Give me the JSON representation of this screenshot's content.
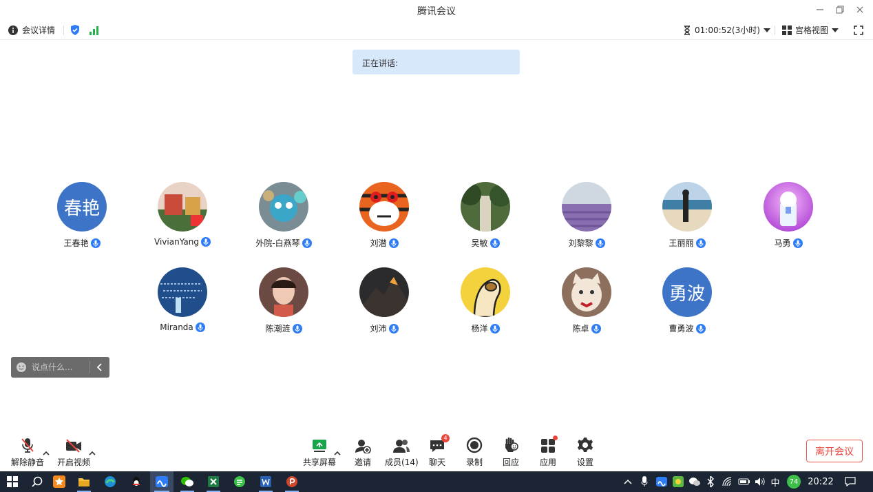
{
  "window": {
    "title": "腾讯会议"
  },
  "infobar": {
    "details_label": "会议详情",
    "timer": "01:00:52(3小时)",
    "view_label": "宫格视图"
  },
  "speaking": {
    "label": "正在讲话:"
  },
  "participants": [
    {
      "name": "王春艳",
      "avatar_text": "春艳"
    },
    {
      "name": "VivianYang"
    },
    {
      "name": "外院-白燕琴"
    },
    {
      "name": "刘潜"
    },
    {
      "name": "吴敏"
    },
    {
      "name": "刘黎黎"
    },
    {
      "name": "王丽丽"
    },
    {
      "name": "马勇"
    },
    {
      "name": "Miranda"
    },
    {
      "name": "陈潮涟"
    },
    {
      "name": "刘沛"
    },
    {
      "name": "杨洋"
    },
    {
      "name": "陈卓"
    },
    {
      "name": "曹勇波",
      "avatar_text": "勇波"
    }
  ],
  "chat": {
    "placeholder": "说点什么..."
  },
  "toolbar": {
    "unmute": "解除静音",
    "video": "开启视频",
    "share": "共享屏幕",
    "invite": "邀请",
    "members": "成员(14)",
    "chat": "聊天",
    "chat_badge": "4",
    "record": "录制",
    "reaction": "回应",
    "apps": "应用",
    "settings": "设置",
    "leave": "离开会议"
  },
  "taskbar": {
    "ime": "中",
    "battery": "74",
    "clock": "20:22"
  },
  "colors": {
    "accent": "#2f7df6",
    "avatar_bg": "#3e74c7",
    "leave": "#e8463d",
    "banner": "#d8e8fb",
    "taskbar": "#1b2533"
  }
}
